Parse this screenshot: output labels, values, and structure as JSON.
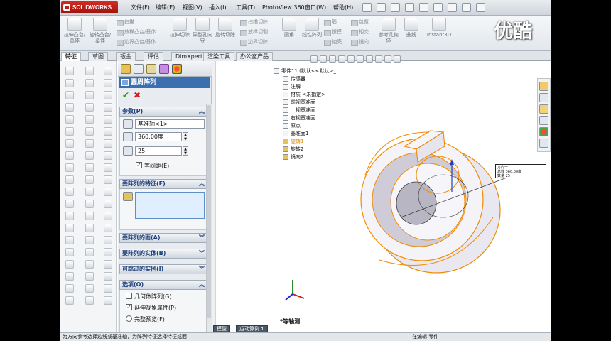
{
  "app": {
    "brand": "SOLIDWORKS",
    "watermark": "优酷"
  },
  "menubar": {
    "items": [
      "文件(F)",
      "编辑(E)",
      "视图(V)",
      "插入(I)",
      "工具(T)",
      "PhotoView 360",
      "窗口(W)",
      "帮助(H)"
    ]
  },
  "ribbon": {
    "big": [
      {
        "label": "拉伸凸台/基体"
      },
      {
        "label": "旋转凸台/基体"
      },
      {
        "label": "拉伸切除"
      },
      {
        "label": "异型孔向导"
      },
      {
        "label": "旋转切除"
      },
      {
        "label": "圆角"
      },
      {
        "label": "线性阵列"
      },
      {
        "label": "参考几何体"
      },
      {
        "label": "曲线"
      },
      {
        "label": "Instant3D"
      }
    ],
    "small": [
      "扫描",
      "放样凸台/基体",
      "边界凸台/基体",
      "扫描切除",
      "放样切割",
      "边界切除",
      "筋",
      "拔模",
      "抽壳",
      "包覆",
      "相交",
      "镜向"
    ]
  },
  "tabs": [
    {
      "label": "特征",
      "active": true
    },
    {
      "label": "草图",
      "active": false
    },
    {
      "label": "钣金",
      "active": false
    },
    {
      "label": "评估",
      "active": false
    },
    {
      "label": "DimXpert",
      "active": false
    },
    {
      "label": "渲染工具",
      "active": false
    },
    {
      "label": "办公室产品",
      "active": false
    }
  ],
  "pm": {
    "title": "圆周阵列",
    "ok": "✔",
    "cancel": "✖",
    "params": {
      "header": "参数(P)",
      "axis": "基准轴<1>",
      "angle": "360.00度",
      "count": "25",
      "equal_spacing": "等间距(E)",
      "equal_spacing_checked": true
    },
    "features": {
      "header": "要阵列的特征(F)"
    },
    "faces": {
      "header": "要阵列的面(A)"
    },
    "bodies": {
      "header": "要阵列的实体(B)"
    },
    "skip": {
      "header": "可跳过的实例(I)"
    },
    "options": {
      "header": "选项(O)",
      "geometry_pattern": "几何体阵列(G)",
      "geometry_pattern_checked": false,
      "propagate_visual": "延伸视象属性(P)",
      "propagate_visual_checked": true,
      "full_preview": "完整预览(F)"
    }
  },
  "tree": {
    "root": "零件11 (默认<<默认>_",
    "items": [
      {
        "label": "传感器",
        "highlight": false
      },
      {
        "label": "注解",
        "highlight": false
      },
      {
        "label": "材质 <未指定>",
        "highlight": false
      },
      {
        "label": "前视基准面",
        "highlight": false
      },
      {
        "label": "上视基准面",
        "highlight": false
      },
      {
        "label": "右视基准面",
        "highlight": false
      },
      {
        "label": "原点",
        "highlight": false
      },
      {
        "label": "基准面1",
        "highlight": false
      },
      {
        "label": "旋转1",
        "highlight": true
      },
      {
        "label": "旋转2",
        "highlight": false
      },
      {
        "label": "镜向2",
        "highlight": false
      }
    ]
  },
  "dim_callout": {
    "line1": "方向一",
    "line2": "总数  360.00度",
    "line3": "数量  25"
  },
  "view_label": "*等轴测",
  "bottom_tabs": [
    "模型",
    "运动算例 1"
  ],
  "status": {
    "left": "为方向参考选择边线或基准轴，为阵列特征选择特征或面",
    "right": "在编辑 零件"
  },
  "colors": {
    "accent_blue": "#3b6fb0",
    "preview_orange": "#f08a00",
    "brand_red": "#c8201a"
  }
}
